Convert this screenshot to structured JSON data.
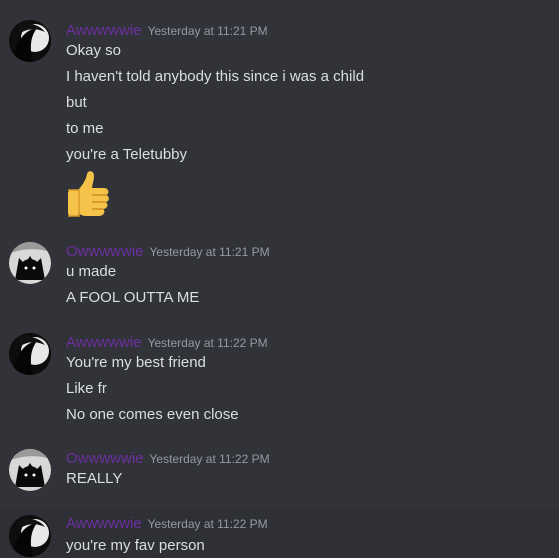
{
  "groups": [
    {
      "author": "Awwwwwie",
      "timestamp": "Yesterday at 11:21 PM",
      "avatar": "awwwwwie-avatar",
      "lines": [
        "Okay so",
        "I haven't told anybody this since i was a child",
        "but",
        "to me",
        "you're a Teletubby"
      ],
      "emoji": "thumbs-up-icon"
    },
    {
      "author": "Owwwwwie",
      "timestamp": "Yesterday at 11:21 PM",
      "avatar": "owwwwwie-avatar",
      "lines": [
        "u made",
        "A FOOL OUTTA ME"
      ]
    },
    {
      "author": "Awwwwwie",
      "timestamp": "Yesterday at 11:22 PM",
      "avatar": "awwwwwie-avatar",
      "lines": [
        "You're my best friend",
        "Like fr",
        "No one comes even close"
      ]
    },
    {
      "author": "Owwwwwie",
      "timestamp": "Yesterday at 11:22 PM",
      "avatar": "owwwwwie-avatar",
      "lines": [
        "REALLY"
      ]
    },
    {
      "author": "Awwwwwie",
      "timestamp": "Yesterday at 11:22 PM",
      "avatar": "awwwwwie-avatar",
      "lines": [
        "you're my fav person"
      ]
    }
  ],
  "colors": {
    "background": "#313338",
    "username": "#6b2fa0",
    "timestamp": "#949ba4",
    "text": "#dbdee1"
  }
}
